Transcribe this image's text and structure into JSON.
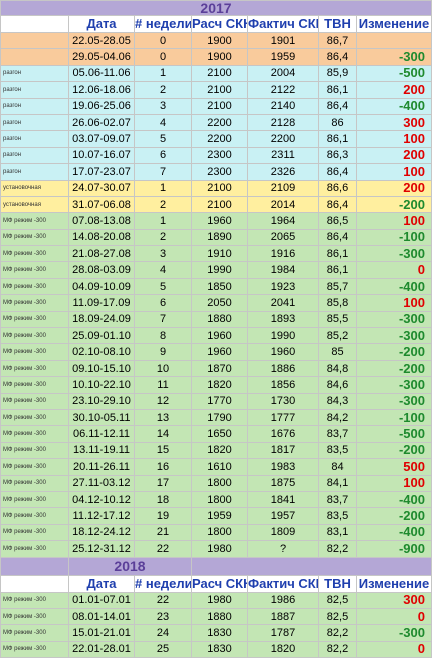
{
  "year_2017": "2017",
  "year_2018": "2018",
  "headers": [
    "",
    "Дата",
    "# недели",
    "Расч СКН",
    "Фактич СКН",
    "ТВН",
    "Изменение"
  ],
  "colors": {
    "increase": "#e00000",
    "decrease": "#1e8a2e",
    "neutral": "#1e1e1e"
  },
  "rows_2017": [
    {
      "group": "initial",
      "label": "",
      "date": "22.05-28.05",
      "week": "0",
      "calc": "1900",
      "fact": "1901",
      "tvn": "86,7",
      "change": ""
    },
    {
      "group": "initial",
      "label": "",
      "date": "29.05-04.06",
      "week": "0",
      "calc": "1900",
      "fact": "1959",
      "tvn": "86,4",
      "change": "-300"
    },
    {
      "group": "razgon",
      "label": "разгон",
      "date": "05.06-11.06",
      "week": "1",
      "calc": "2100",
      "fact": "2004",
      "tvn": "85,9",
      "change": "-500"
    },
    {
      "group": "razgon",
      "label": "разгон",
      "date": "12.06-18.06",
      "week": "2",
      "calc": "2100",
      "fact": "2122",
      "tvn": "86,1",
      "change": "200"
    },
    {
      "group": "razgon",
      "label": "разгон",
      "date": "19.06-25.06",
      "week": "3",
      "calc": "2100",
      "fact": "2140",
      "tvn": "86,4",
      "change": "-400"
    },
    {
      "group": "razgon",
      "label": "разгон",
      "date": "26.06-02.07",
      "week": "4",
      "calc": "2200",
      "fact": "2128",
      "tvn": "86",
      "change": "300"
    },
    {
      "group": "razgon",
      "label": "разгон",
      "date": "03.07-09.07",
      "week": "5",
      "calc": "2200",
      "fact": "2200",
      "tvn": "86,1",
      "change": "100"
    },
    {
      "group": "razgon",
      "label": "разгон",
      "date": "10.07-16.07",
      "week": "6",
      "calc": "2300",
      "fact": "2311",
      "tvn": "86,3",
      "change": "200"
    },
    {
      "group": "razgon",
      "label": "разгон",
      "date": "17.07-23.07",
      "week": "7",
      "calc": "2300",
      "fact": "2326",
      "tvn": "86,4",
      "change": "100"
    },
    {
      "group": "ustanov",
      "label": "установочная",
      "date": "24.07-30.07",
      "week": "1",
      "calc": "2100",
      "fact": "2109",
      "tvn": "86,6",
      "change": "200"
    },
    {
      "group": "ustanov",
      "label": "установочная",
      "date": "31.07-06.08",
      "week": "2",
      "calc": "2100",
      "fact": "2014",
      "tvn": "86,4",
      "change": "-200"
    },
    {
      "group": "mf",
      "label": "МФ режим -300",
      "date": "07.08-13.08",
      "week": "1",
      "calc": "1960",
      "fact": "1964",
      "tvn": "86,5",
      "change": "100"
    },
    {
      "group": "mf",
      "label": "МФ режим -300",
      "date": "14.08-20.08",
      "week": "2",
      "calc": "1890",
      "fact": "2065",
      "tvn": "86,4",
      "change": "-100"
    },
    {
      "group": "mf",
      "label": "МФ режим -300",
      "date": "21.08-27.08",
      "week": "3",
      "calc": "1910",
      "fact": "1916",
      "tvn": "86,1",
      "change": "-300"
    },
    {
      "group": "mf",
      "label": "МФ режим -300",
      "date": "28.08-03.09",
      "week": "4",
      "calc": "1990",
      "fact": "1984",
      "tvn": "86,1",
      "change": "0"
    },
    {
      "group": "mf",
      "label": "МФ режим -300",
      "date": "04.09-10.09",
      "week": "5",
      "calc": "1850",
      "fact": "1923",
      "tvn": "85,7",
      "change": "-400"
    },
    {
      "group": "mf",
      "label": "МФ режим -300",
      "date": "11.09-17.09",
      "week": "6",
      "calc": "2050",
      "fact": "2041",
      "tvn": "85,8",
      "change": "100"
    },
    {
      "group": "mf",
      "label": "МФ режим -300",
      "date": "18.09-24.09",
      "week": "7",
      "calc": "1880",
      "fact": "1893",
      "tvn": "85,5",
      "change": "-300"
    },
    {
      "group": "mf",
      "label": "МФ режим -300",
      "date": "25.09-01.10",
      "week": "8",
      "calc": "1960",
      "fact": "1990",
      "tvn": "85,2",
      "change": "-300"
    },
    {
      "group": "mf",
      "label": "МФ режим -300",
      "date": "02.10-08.10",
      "week": "9",
      "calc": "1960",
      "fact": "1960",
      "tvn": "85",
      "change": "-200"
    },
    {
      "group": "mf",
      "label": "МФ режим -300",
      "date": "09.10-15.10",
      "week": "10",
      "calc": "1870",
      "fact": "1886",
      "tvn": "84,8",
      "change": "-200"
    },
    {
      "group": "mf",
      "label": "МФ режим -300",
      "date": "10.10-22.10",
      "week": "11",
      "calc": "1820",
      "fact": "1856",
      "tvn": "84,6",
      "change": "-300"
    },
    {
      "group": "mf",
      "label": "МФ режим -300",
      "date": "23.10-29.10",
      "week": "12",
      "calc": "1770",
      "fact": "1730",
      "tvn": "84,3",
      "change": "-300"
    },
    {
      "group": "mf",
      "label": "МФ режим -300",
      "date": "30.10-05.11",
      "week": "13",
      "calc": "1790",
      "fact": "1777",
      "tvn": "84,2",
      "change": "-100"
    },
    {
      "group": "mf",
      "label": "МФ режим -300",
      "date": "06.11-12.11",
      "week": "14",
      "calc": "1650",
      "fact": "1676",
      "tvn": "83,7",
      "change": "-500"
    },
    {
      "group": "mf",
      "label": "МФ режим -300",
      "date": "13.11-19.11",
      "week": "15",
      "calc": "1820",
      "fact": "1817",
      "tvn": "83,5",
      "change": "-200"
    },
    {
      "group": "mf",
      "label": "МФ режим -300",
      "date": "20.11-26.11",
      "week": "16",
      "calc": "1610",
      "fact": "1983",
      "tvn": "84",
      "change": "500"
    },
    {
      "group": "mf",
      "label": "МФ режим -300",
      "date": "27.11-03.12",
      "week": "17",
      "calc": "1800",
      "fact": "1875",
      "tvn": "84,1",
      "change": "100"
    },
    {
      "group": "mf",
      "label": "МФ режим -300",
      "date": "04.12-10.12",
      "week": "18",
      "calc": "1800",
      "fact": "1841",
      "tvn": "83,7",
      "change": "-400"
    },
    {
      "group": "mf",
      "label": "МФ режим -300",
      "date": "11.12-17.12",
      "week": "19",
      "calc": "1959",
      "fact": "1957",
      "tvn": "83,5",
      "change": "-200"
    },
    {
      "group": "mf",
      "label": "МФ режим -300",
      "date": "18.12-24.12",
      "week": "21",
      "calc": "1800",
      "fact": "1809",
      "tvn": "83,1",
      "change": "-400"
    },
    {
      "group": "mf",
      "label": "МФ режим -300",
      "date": "25.12-31.12",
      "week": "22",
      "calc": "1980",
      "fact": "?",
      "tvn": "82,2",
      "change": "-900"
    }
  ],
  "rows_2018": [
    {
      "group": "mf2",
      "label": "МФ режим -300",
      "date": "01.01-07.01",
      "week": "22",
      "calc": "1980",
      "fact": "1986",
      "tvn": "82,5",
      "change": "300"
    },
    {
      "group": "mf2",
      "label": "МФ режим -300",
      "date": "08.01-14.01",
      "week": "23",
      "calc": "1880",
      "fact": "1887",
      "tvn": "82,5",
      "change": "0"
    },
    {
      "group": "mf2",
      "label": "МФ режим -300",
      "date": "15.01-21.01",
      "week": "24",
      "calc": "1830",
      "fact": "1787",
      "tvn": "82,2",
      "change": "-300"
    },
    {
      "group": "mf2",
      "label": "МФ режим -300",
      "date": "22.01-28.01",
      "week": "25",
      "calc": "1830",
      "fact": "1820",
      "tvn": "82,2",
      "change": "0"
    }
  ]
}
